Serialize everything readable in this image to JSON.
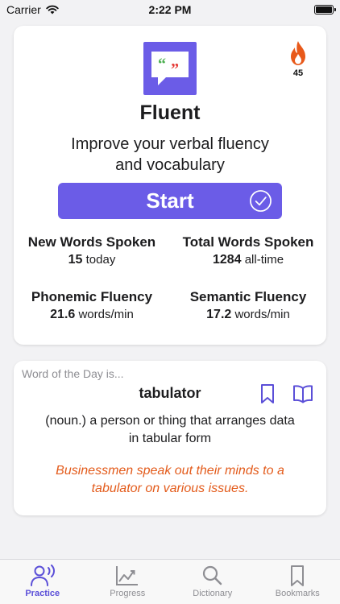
{
  "status_bar": {
    "carrier": "Carrier",
    "time": "2:22 PM"
  },
  "header": {
    "title": "Fluent",
    "tagline_line1": "Improve your verbal fluency",
    "tagline_line2": "and vocabulary",
    "streak_count": "45",
    "start_label": "Start"
  },
  "stats": [
    {
      "title": "New Words Spoken",
      "value": "15",
      "unit": "today"
    },
    {
      "title": "Total Words Spoken",
      "value": "1284",
      "unit": "all-time"
    },
    {
      "title": "Phonemic Fluency",
      "value": "21.6",
      "unit": "words/min"
    },
    {
      "title": "Semantic Fluency",
      "value": "17.2",
      "unit": "words/min"
    }
  ],
  "word_of_day": {
    "prefix": "Word of the Day is...",
    "word": "tabulator",
    "definition_line1": "(noun.) a person or thing that arranges data",
    "definition_line2": "in tabular form",
    "example_line1": "Businessmen speak out their minds to a",
    "example_line2": "tabulator on various issues."
  },
  "tabs": [
    {
      "label": "Practice",
      "icon": "practice-icon",
      "active": true
    },
    {
      "label": "Progress",
      "icon": "progress-icon",
      "active": false
    },
    {
      "label": "Dictionary",
      "icon": "dictionary-icon",
      "active": false
    },
    {
      "label": "Bookmarks",
      "icon": "bookmarks-icon",
      "active": false
    }
  ],
  "colors": {
    "accent": "#6b5ce7",
    "example_text": "#e35b1b",
    "flame": "#e8591a",
    "quote_green": "#4caf50",
    "quote_red": "#e53935"
  }
}
